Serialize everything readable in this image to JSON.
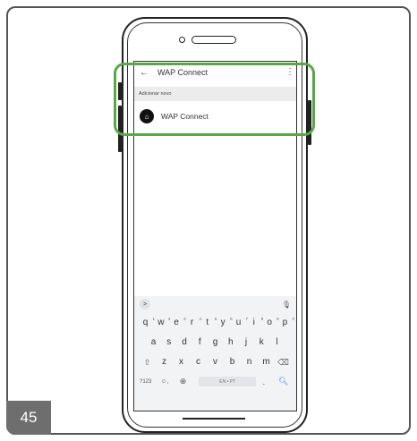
{
  "page": {
    "number": "45"
  },
  "app": {
    "title": "WAP Connect",
    "back_icon": "arrow-left-icon",
    "menu_icon": "more-vert-icon",
    "section_header": "Adicionar novo",
    "list_item": {
      "label": "WAP Connect",
      "icon": "home-gear-icon"
    }
  },
  "keyboard": {
    "row1": [
      {
        "k": "q",
        "n": "1"
      },
      {
        "k": "w",
        "n": "2"
      },
      {
        "k": "e",
        "n": "3"
      },
      {
        "k": "r",
        "n": "4"
      },
      {
        "k": "t",
        "n": "5"
      },
      {
        "k": "y",
        "n": "6"
      },
      {
        "k": "u",
        "n": "7"
      },
      {
        "k": "i",
        "n": "8"
      },
      {
        "k": "o",
        "n": "9"
      },
      {
        "k": "p",
        "n": "0"
      }
    ],
    "row2": [
      "a",
      "s",
      "d",
      "f",
      "g",
      "h",
      "j",
      "k",
      "l"
    ],
    "row3": [
      "z",
      "x",
      "c",
      "v",
      "b",
      "n",
      "m"
    ],
    "key_123": "?123",
    "emoji_key": "☺",
    "comma": ",",
    "space_label": "EN • PT",
    "period": "."
  },
  "colors": {
    "highlight": "#58a845",
    "search_key": "#2b7de9"
  }
}
